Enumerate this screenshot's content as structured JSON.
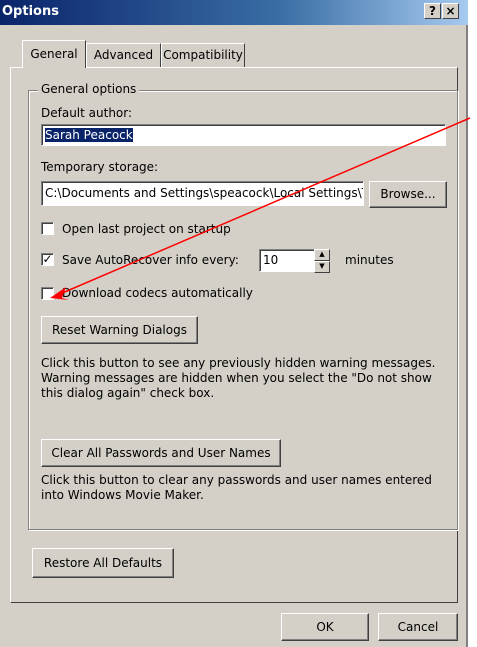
{
  "window": {
    "title": "Options",
    "help_glyph": "?",
    "close_glyph": "×"
  },
  "tabs": [
    {
      "label": "General"
    },
    {
      "label": "Advanced"
    },
    {
      "label": "Compatibility"
    }
  ],
  "group": {
    "legend": "General options",
    "default_author": {
      "label": "Default author:",
      "value": "Sarah Peacock"
    },
    "temp_storage": {
      "label": "Temporary storage:",
      "value": "C:\\Documents and Settings\\speacock\\Local Settings\\Temp",
      "browse_label": "Browse..."
    },
    "open_last_project": {
      "label": "Open last project on startup",
      "checked": false
    },
    "save_autorecover": {
      "label": "Save AutoRecover info every:",
      "checked": true,
      "value": "10",
      "unit": "minutes"
    },
    "download_codecs": {
      "label": "Download codecs automatically",
      "checked": false
    },
    "reset_warning": {
      "button": "Reset Warning Dialogs",
      "description_lines": [
        "Click this button to see any previously hidden warning messages.",
        "Warning messages are hidden when you select the \"Do not show",
        "this dialog again\" check box."
      ]
    },
    "clear_passwords": {
      "button": "Clear All Passwords and User Names",
      "description_lines": [
        "Click this button to clear any passwords and user names entered",
        "into Windows Movie Maker."
      ]
    }
  },
  "restore_defaults": "Restore All Defaults",
  "footer": {
    "ok": "OK",
    "cancel": "Cancel"
  },
  "annotation": {
    "color": "#ff0000"
  },
  "colors": {
    "title_bar": "#0a246a",
    "dialog_bg": "#d4d0c8",
    "selection": "#0a246a"
  }
}
